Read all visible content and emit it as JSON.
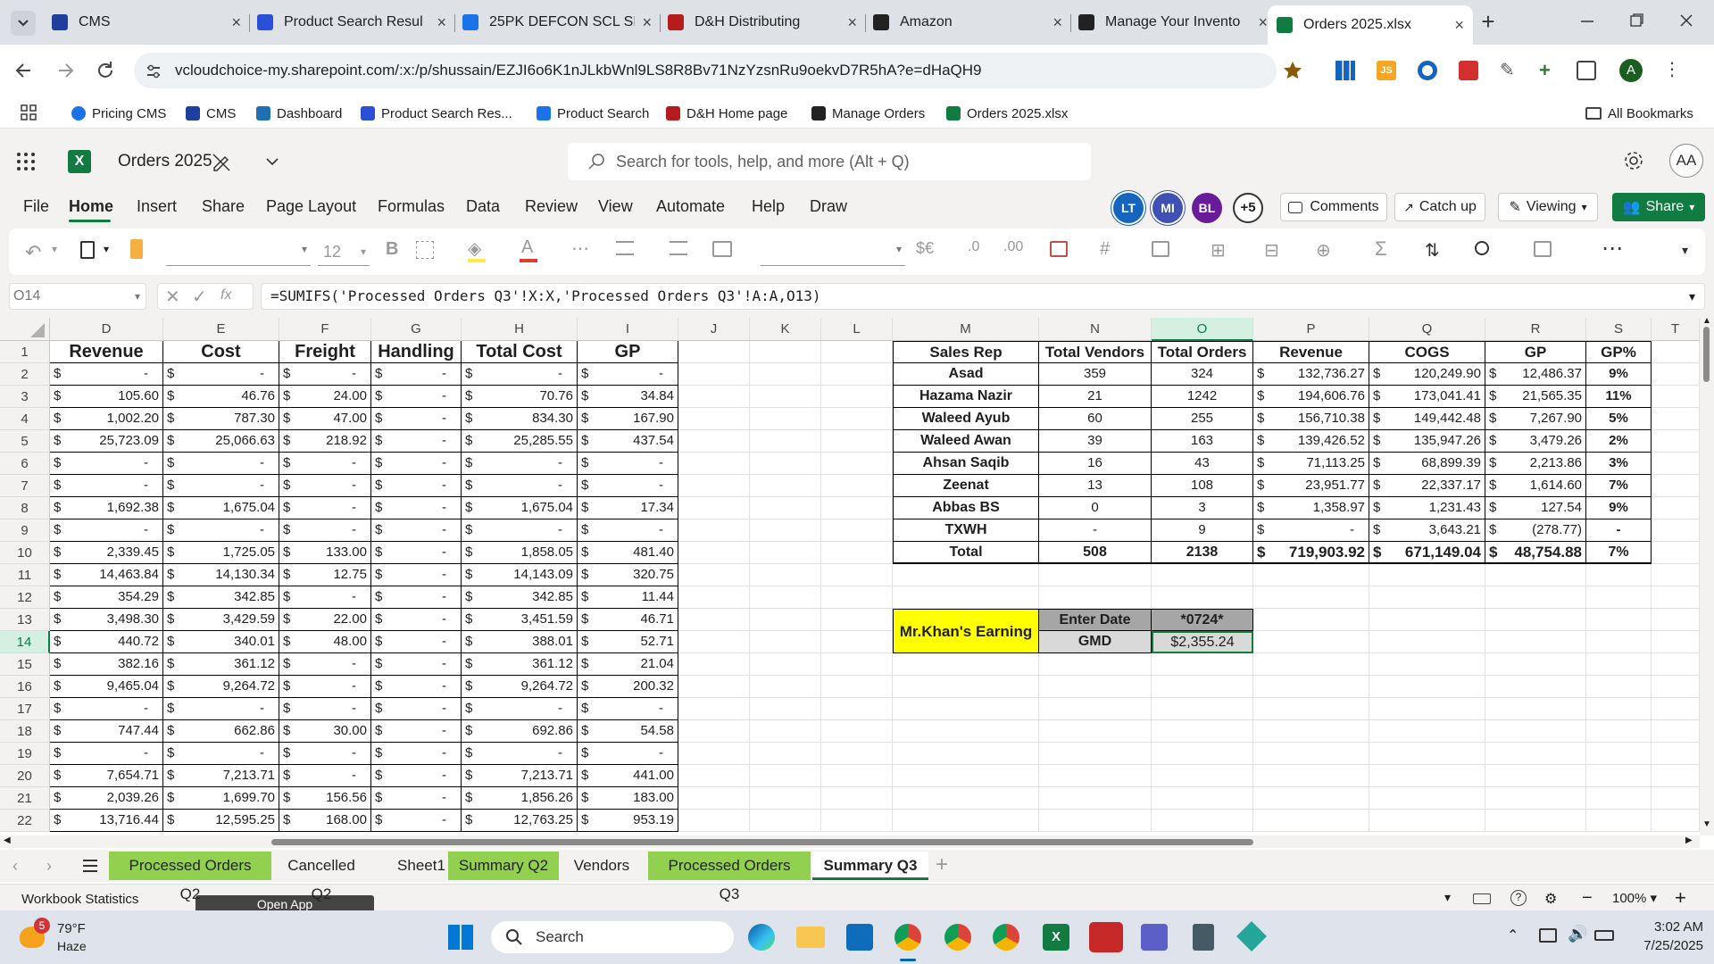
{
  "browser": {
    "tabs": [
      {
        "title": "CMS",
        "icon": "cms-favicon",
        "color": "#1f3f9f"
      },
      {
        "title": "Product Search Resul",
        "icon": "product-search-favicon",
        "color": "#2b4fd6"
      },
      {
        "title": "25PK DEFCON SCL SI",
        "icon": "defcon-favicon",
        "color": "#1a73e8"
      },
      {
        "title": "D&H Distributing",
        "icon": "dh-favicon",
        "color": "#b71c1c"
      },
      {
        "title": "Amazon",
        "icon": "amazon-favicon",
        "color": "#222222"
      },
      {
        "title": "Manage Your Invento",
        "icon": "amazon-favicon",
        "color": "#222222"
      },
      {
        "title": "Orders 2025.xlsx",
        "icon": "excel-favicon",
        "color": "#107c41"
      }
    ],
    "url": "vcloudchoice-my.sharepoint.com/:x:/p/shussain/EZJI6o6K1nJLkbWnl9LS8R8Bv71NzYzsnRu9oekvD7R5hA?e=dHaQH9",
    "bookmarks": [
      {
        "label": "Pricing CMS",
        "color": "#1a73e8"
      },
      {
        "label": "CMS",
        "color": "#1f3f9f"
      },
      {
        "label": "Dashboard",
        "color": "#1f6fb5"
      },
      {
        "label": "Product Search Res...",
        "color": "#2b4fd6"
      },
      {
        "label": "Product Search",
        "color": "#1a73e8"
      },
      {
        "label": "D&H Home page",
        "color": "#b71c1c"
      },
      {
        "label": "Manage Orders",
        "color": "#222222"
      },
      {
        "label": "Orders 2025.xlsx",
        "color": "#107c41"
      }
    ],
    "all_bookmarks": "All Bookmarks",
    "profile_initial": "A"
  },
  "excel": {
    "doc_title": "Orders 2025",
    "search_placeholder": "Search for tools, help, and more (Alt + Q)",
    "user_initials": "AA",
    "menu": [
      "File",
      "Home",
      "Insert",
      "Share",
      "Page Layout",
      "Formulas",
      "Data",
      "Review",
      "View",
      "Automate",
      "Help",
      "Draw"
    ],
    "active_menu": "Home",
    "collaborators": [
      {
        "initials": "LT",
        "color": "#1565c0"
      },
      {
        "initials": "MI",
        "color": "#3f51b5"
      },
      {
        "initials": "BL",
        "color": "#6a1b9a"
      }
    ],
    "more_collab": "+5",
    "comments_label": "Comments",
    "catchup_label": "Catch up",
    "viewing_label": "Viewing",
    "share_label": "Share",
    "font_size": "12",
    "name_box": "O14",
    "formula": "=SUMIFS('Processed Orders Q3'!X:X,'Processed Orders Q3'!A:A,O13)",
    "columns": [
      "D",
      "E",
      "F",
      "G",
      "H",
      "I",
      "J",
      "K",
      "L",
      "M",
      "N",
      "O",
      "P",
      "Q",
      "R",
      "S",
      "T"
    ],
    "selected_column": "O",
    "selected_row": "14",
    "rows": [
      "1",
      "2",
      "3",
      "4",
      "5",
      "6",
      "7",
      "8",
      "9",
      "10",
      "11",
      "12",
      "13",
      "14",
      "15",
      "16",
      "17",
      "18",
      "19",
      "20",
      "21",
      "22"
    ],
    "left_headers": [
      "Revenue",
      "Cost",
      "Freight",
      "Handling",
      "Total Cost",
      "GP"
    ],
    "left_rows": [
      [
        "-",
        "-",
        "-",
        "-",
        "-",
        "-"
      ],
      [
        "105.60",
        "46.76",
        "24.00",
        "-",
        "70.76",
        "34.84"
      ],
      [
        "1,002.20",
        "787.30",
        "47.00",
        "-",
        "834.30",
        "167.90"
      ],
      [
        "25,723.09",
        "25,066.63",
        "218.92",
        "-",
        "25,285.55",
        "437.54"
      ],
      [
        "-",
        "-",
        "-",
        "-",
        "-",
        "-"
      ],
      [
        "-",
        "-",
        "-",
        "-",
        "-",
        "-"
      ],
      [
        "1,692.38",
        "1,675.04",
        "-",
        "-",
        "1,675.04",
        "17.34"
      ],
      [
        "-",
        "-",
        "-",
        "-",
        "-",
        "-"
      ],
      [
        "2,339.45",
        "1,725.05",
        "133.00",
        "-",
        "1,858.05",
        "481.40"
      ],
      [
        "14,463.84",
        "14,130.34",
        "12.75",
        "-",
        "14,143.09",
        "320.75"
      ],
      [
        "354.29",
        "342.85",
        "-",
        "-",
        "342.85",
        "11.44"
      ],
      [
        "3,498.30",
        "3,429.59",
        "22.00",
        "-",
        "3,451.59",
        "46.71"
      ],
      [
        "440.72",
        "340.01",
        "48.00",
        "-",
        "388.01",
        "52.71"
      ],
      [
        "382.16",
        "361.12",
        "-",
        "-",
        "361.12",
        "21.04"
      ],
      [
        "9,465.04",
        "9,264.72",
        "-",
        "-",
        "9,264.72",
        "200.32"
      ],
      [
        "-",
        "-",
        "-",
        "-",
        "-",
        "-"
      ],
      [
        "747.44",
        "662.86",
        "30.00",
        "-",
        "692.86",
        "54.58"
      ],
      [
        "-",
        "-",
        "-",
        "-",
        "-",
        "-"
      ],
      [
        "7,654.71",
        "7,213.71",
        "-",
        "-",
        "7,213.71",
        "441.00"
      ],
      [
        "2,039.26",
        "1,699.70",
        "156.56",
        "-",
        "1,856.26",
        "183.00"
      ],
      [
        "13,716.44",
        "12,595.25",
        "168.00",
        "-",
        "12,763.25",
        "953.19"
      ]
    ],
    "summary_headers": [
      "Sales Rep",
      "Total Vendors",
      "Total Orders",
      "Revenue",
      "COGS",
      "GP",
      "GP%"
    ],
    "summary_rows": [
      [
        "Asad",
        "359",
        "324",
        "132,736.27",
        "120,249.90",
        "12,486.37",
        "9%"
      ],
      [
        "Hazama Nazir",
        "21",
        "1242",
        "194,606.76",
        "173,041.41",
        "21,565.35",
        "11%"
      ],
      [
        "Waleed Ayub",
        "60",
        "255",
        "156,710.38",
        "149,442.48",
        "7,267.90",
        "5%"
      ],
      [
        "Waleed Awan",
        "39",
        "163",
        "139,426.52",
        "135,947.26",
        "3,479.26",
        "2%"
      ],
      [
        "Ahsan Saqib",
        "16",
        "43",
        "71,113.25",
        "68,899.39",
        "2,213.86",
        "3%"
      ],
      [
        "Zeenat",
        "13",
        "108",
        "23,951.77",
        "22,337.17",
        "1,614.60",
        "7%"
      ],
      [
        "Abbas BS",
        "0",
        "3",
        "1,358.97",
        "1,231.43",
        "127.54",
        "9%"
      ],
      [
        "TXWH",
        "-",
        "9",
        "-",
        "3,643.21",
        "(278.77)",
        "-"
      ]
    ],
    "summary_total": [
      "Total",
      "508",
      "2138",
      "719,903.92",
      "671,149.04",
      "48,754.88",
      "7%"
    ],
    "currency": "$",
    "earning_label": "Mr.Khan's Earning",
    "enter_date_label": "Enter Date",
    "enter_date_value": "*0724*",
    "gmd_label": "GMD",
    "gmd_value": "$2,355.24",
    "sheets": [
      {
        "name": "Processed Orders Q2",
        "green": true
      },
      {
        "name": "Cancelled Q2",
        "green": false
      },
      {
        "name": "Sheet1",
        "green": false
      },
      {
        "name": "Summary Q2",
        "green": true
      },
      {
        "name": "Vendors",
        "green": false
      },
      {
        "name": "Processed Orders Q3",
        "green": true
      },
      {
        "name": "Summary Q3",
        "green": false
      }
    ],
    "active_sheet": "Summary Q3",
    "workbook_stats": "Workbook Statistics",
    "open_app": "Open App",
    "zoom": "100%"
  },
  "taskbar": {
    "weather_temp": "79°F",
    "weather_desc": "Haze",
    "weather_badge": "5",
    "search_label": "Search",
    "time": "3:02 AM",
    "date": "7/25/2025"
  }
}
